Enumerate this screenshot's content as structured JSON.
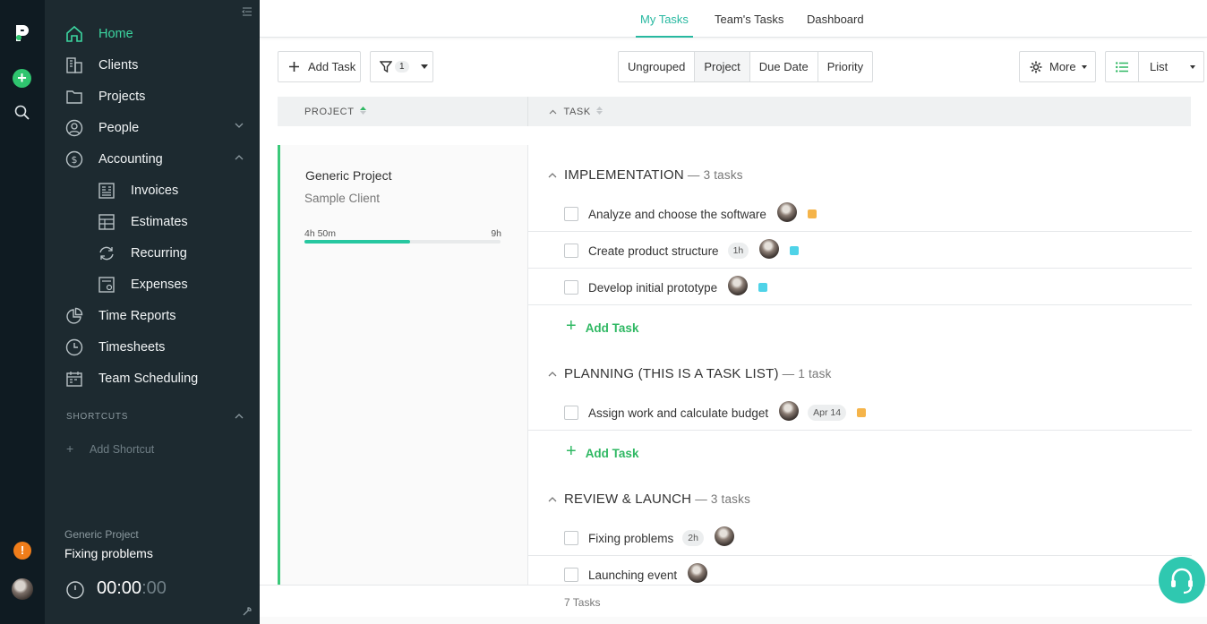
{
  "colors": {
    "accent": "#27b8a0",
    "green": "#2fb863",
    "orange": "#f5b44a",
    "cyan": "#4fd3e8",
    "sidebar": "#1d2a30",
    "rail": "#0f1b22"
  },
  "rail": {
    "logo": "p-logo-icon",
    "add": "+",
    "alert": "!"
  },
  "sidebar": {
    "items": [
      {
        "label": "Home",
        "icon": "home-icon"
      },
      {
        "label": "Clients",
        "icon": "building-icon"
      },
      {
        "label": "Projects",
        "icon": "folder-icon"
      },
      {
        "label": "People",
        "icon": "user-icon"
      },
      {
        "label": "Accounting",
        "icon": "dollar-icon"
      },
      {
        "label": "Invoices",
        "icon": "invoice-icon"
      },
      {
        "label": "Estimates",
        "icon": "table-icon"
      },
      {
        "label": "Recurring",
        "icon": "refresh-icon"
      },
      {
        "label": "Expenses",
        "icon": "receipt-icon"
      },
      {
        "label": "Time Reports",
        "icon": "pie-icon"
      },
      {
        "label": "Timesheets",
        "icon": "clock-icon"
      },
      {
        "label": "Team Scheduling",
        "icon": "calendar-icon"
      }
    ],
    "shortcuts_label": "SHORTCUTS",
    "add_shortcut": "Add Shortcut",
    "timer": {
      "project": "Generic Project",
      "task": "Fixing problems",
      "time_main": "00:00",
      "time_dim": ":00"
    }
  },
  "tabs": [
    "My Tasks",
    "Team's Tasks",
    "Dashboard"
  ],
  "toolbar": {
    "add_task": "Add Task",
    "filter_count": "1",
    "grouping": [
      "Ungrouped",
      "Project",
      "Due Date",
      "Priority"
    ],
    "more": "More",
    "view": "List"
  },
  "table_header": {
    "project": "PROJECT",
    "task": "TASK"
  },
  "project": {
    "name": "Generic Project",
    "client": "Sample Client",
    "logged": "4h 50m",
    "estimate": "9h",
    "progress": 0.54
  },
  "groups": [
    {
      "title": "IMPLEMENTATION",
      "count": "— 3 tasks",
      "tasks": [
        {
          "name": "Analyze and choose the software",
          "pill": "",
          "color": "#f5b44a"
        },
        {
          "name": "Create product structure",
          "pill": "1h",
          "color": "#4fd3e8"
        },
        {
          "name": "Develop initial prototype",
          "pill": "",
          "color": "#4fd3e8"
        }
      ]
    },
    {
      "title": "PLANNING (THIS IS A TASK LIST)",
      "count": "— 1 task",
      "tasks": [
        {
          "name": "Assign work and calculate budget",
          "pill": "Apr 14",
          "color": "#f5b44a"
        }
      ]
    },
    {
      "title": "REVIEW & LAUNCH",
      "count": "— 3 tasks",
      "tasks": [
        {
          "name": "Fixing problems",
          "pill": "2h",
          "color": ""
        },
        {
          "name": "Launching event",
          "pill": "",
          "color": ""
        }
      ]
    }
  ],
  "add_task_link": "Add Task",
  "footer": {
    "count": "7 Tasks"
  }
}
